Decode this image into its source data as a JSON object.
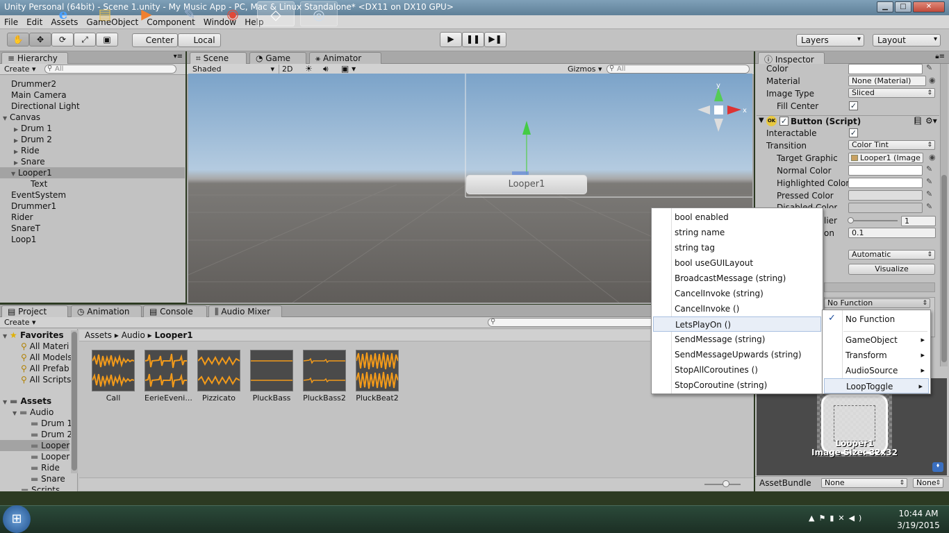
{
  "window": {
    "title": "Unity Personal (64bit) - Scene 1.unity - My Music App - PC, Mac & Linux Standalone* <DX11 on DX10 GPU>"
  },
  "menubar": [
    "File",
    "Edit",
    "Assets",
    "GameObject",
    "Component",
    "Window",
    "Help"
  ],
  "toolbar": {
    "pivot": "Center",
    "space": "Local",
    "layers": "Layers",
    "layout": "Layout"
  },
  "hierarchy": {
    "tab": "Hierarchy",
    "create": "Create",
    "search_placeholder": "All",
    "items": [
      "Drummer2",
      "Main Camera",
      "Directional Light",
      "Canvas",
      "Drum 1",
      "Drum 2",
      "Ride",
      "Snare",
      "Looper1",
      "Text",
      "EventSystem",
      "Drummer1",
      "Rider",
      "SnareT",
      "Loop1"
    ]
  },
  "scene": {
    "tabs": [
      "Scene",
      "Game",
      "Animator"
    ],
    "shading": "Shaded",
    "mode2d": "2D",
    "gizmos": "Gizmos",
    "search_placeholder": "All",
    "object_label": "Looper1",
    "axis_y": "y",
    "axis_x": "x"
  },
  "inspector": {
    "tab": "Inspector",
    "image": {
      "color_label": "Color",
      "material_label": "Material",
      "material_value": "None (Material)",
      "image_type_label": "Image Type",
      "image_type_value": "Sliced",
      "fill_center_label": "Fill Center"
    },
    "button": {
      "header": "Button (Script)",
      "interactable_label": "Interactable",
      "transition_label": "Transition",
      "transition_value": "Color Tint",
      "target_graphic_label": "Target Graphic",
      "target_graphic_value": "Looper1 (Image",
      "normal_label": "Normal Color",
      "highlighted_label": "Highlighted Color",
      "pressed_label": "Pressed Color",
      "disabled_label": "Disabled Color",
      "multiplier_partial": "lier",
      "multiplier_value": "1",
      "duration_partial": "on",
      "duration_value": "0.1",
      "navigation_value": "Automatic",
      "visualize": "Visualize"
    },
    "onclick_value": "No Function",
    "preview": {
      "name": "Looper1",
      "size": "Image Size: 32x32"
    },
    "assetbundle": {
      "label": "AssetBundle",
      "value": "None",
      "variant": "None"
    }
  },
  "method_menu": {
    "items": [
      "bool enabled",
      "string name",
      "string tag",
      "bool useGUILayout",
      "BroadcastMessage (string)",
      "CancelInvoke (string)",
      "CancelInvoke ()",
      "LetsPlayOn ()",
      "SendMessage (string)",
      "SendMessageUpwards (string)",
      "StopAllCoroutines ()",
      "StopCoroutine (string)"
    ]
  },
  "function_menu": {
    "items": [
      "No Function",
      "GameObject",
      "Transform",
      "AudioSource",
      "LoopToggle"
    ],
    "check": "✓"
  },
  "project": {
    "tabs": [
      "Project",
      "Animation",
      "Console",
      "Audio Mixer"
    ],
    "create": "Create",
    "favorites_label": "Favorites",
    "favorites": [
      "All Materi",
      "All Models",
      "All Prefab",
      "All Scripts"
    ],
    "assets_label": "Assets",
    "audio_label": "Audio",
    "folders": [
      "Drum 1",
      "Drum 2",
      "Looper",
      "Looper",
      "Ride",
      "Snare"
    ],
    "scripts_partial": "Scripts",
    "breadcrumb": [
      "Assets",
      "Audio",
      "Looper1"
    ],
    "assets": [
      "Call",
      "EerieEveni...",
      "Pizzicato",
      "PluckBass",
      "PluckBass2",
      "PluckBeat2"
    ]
  },
  "taskbar": {
    "time": "10:44 AM",
    "date": "3/19/2015"
  },
  "colors": {
    "unity_panel": "#c2c2c2",
    "tab_strip": "#a8a8a8",
    "waveform": "#f29a1a",
    "selection": "#a3a3a3"
  }
}
